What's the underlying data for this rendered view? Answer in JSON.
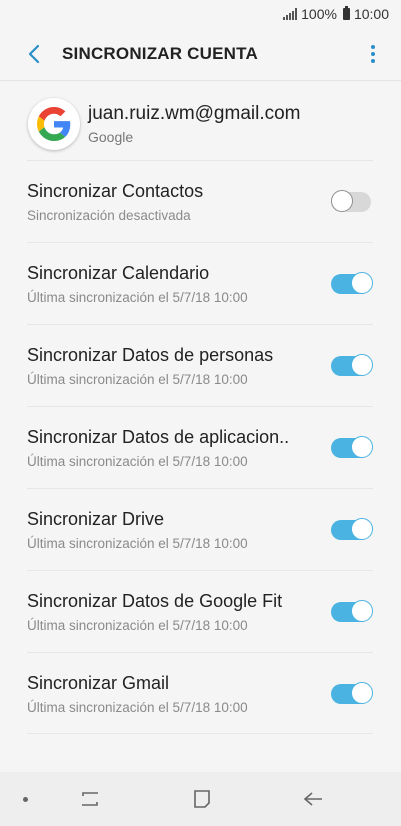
{
  "status_bar": {
    "battery": "100%",
    "time": "10:00"
  },
  "header": {
    "title": "SINCRONIZAR CUENTA"
  },
  "account": {
    "email": "juan.ruiz.wm@gmail.com",
    "type": "Google"
  },
  "sync_items": [
    {
      "title": "Sincronizar Contactos",
      "subtitle": "Sincronización desactivada",
      "enabled": false
    },
    {
      "title": "Sincronizar Calendario",
      "subtitle": "Última sincronización el 5/7/18  10:00",
      "enabled": true
    },
    {
      "title": "Sincronizar Datos de personas",
      "subtitle": "Última sincronización el 5/7/18  10:00",
      "enabled": true
    },
    {
      "title": "Sincronizar Datos de aplicacion..",
      "subtitle": "Última sincronización el 5/7/18  10:00",
      "enabled": true
    },
    {
      "title": "Sincronizar Drive",
      "subtitle": "Última sincronización el 5/7/18  10:00",
      "enabled": true
    },
    {
      "title": "Sincronizar Datos de Google Fit",
      "subtitle": "Última sincronización el 5/7/18  10:00",
      "enabled": true
    },
    {
      "title": "Sincronizar Gmail",
      "subtitle": "Última sincronización el 5/7/18  10:00",
      "enabled": true
    }
  ],
  "icons": {
    "back": "arrow-left-icon",
    "more": "more-vert-icon",
    "avatar": "google-logo-icon",
    "nav_recent": "recent-apps-icon",
    "nav_home": "home-icon",
    "nav_back": "back-icon"
  },
  "colors": {
    "accent": "#4ab3e2",
    "toggle_off": "#d8d8d8",
    "more_icon": "#2a8ec8"
  }
}
